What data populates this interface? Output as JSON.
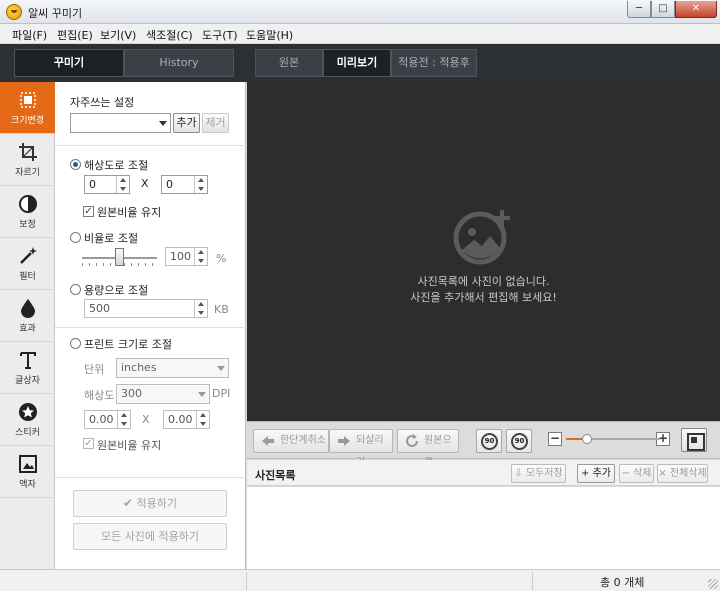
{
  "window": {
    "title": "알씨 꾸미기",
    "min": "─",
    "max": "□",
    "close": "✕"
  },
  "menu": [
    "파일(F)",
    "편집(E)",
    "보기(V)",
    "색조절(C)",
    "도구(T)",
    "도움말(H)"
  ],
  "mode_tabs": {
    "edit": "꾸미기",
    "history": "History"
  },
  "view_tabs": {
    "original": "원본",
    "preview": "미리보기",
    "before_after": "적용전 : 적용후"
  },
  "tools": [
    "크기변경",
    "자르기",
    "보정",
    "필터",
    "효과",
    "글상자",
    "스티커",
    "액자"
  ],
  "panel": {
    "favorites_label": "자주쓰는 설정",
    "favorites_value": "",
    "add_button": "추가",
    "remove_button": "제거",
    "resolution": {
      "label": "해상도로 조절",
      "width": "0",
      "height": "0",
      "x_sep": "X",
      "keep_ratio": "원본비율 유지"
    },
    "ratio": {
      "label": "비율로 조절",
      "value": "100",
      "unit": "%",
      "slider_percent": 50
    },
    "filesize": {
      "label": "용량으로 조절",
      "value": "500",
      "unit": "KB"
    },
    "print": {
      "label": "프린트 크기로 조절",
      "unit_label": "단위",
      "unit_value": "inches",
      "dpi_label": "해상도",
      "dpi_value": "300",
      "dpi_unit": "DPI",
      "width": "0.00",
      "height": "0.00",
      "x_sep": "X",
      "keep_ratio": "원본비율 유지"
    },
    "apply_button": "적용하기",
    "apply_all_button": "모든 사진에 적용하기"
  },
  "preview": {
    "message_line1": "사진목록에 사진이 없습니다.",
    "message_line2": "사진을 추가해서 편집해 보세요!"
  },
  "edit_toolbar": {
    "undo": "한단계취소",
    "redo": "되살리기",
    "restore": "원본으로",
    "rotate_left": "90",
    "rotate_right": "90",
    "zoom_minus": "−",
    "zoom_plus": "+",
    "zoom_percent": 22
  },
  "photo_list": {
    "title": "사진목록",
    "save_all": "모두저장",
    "add": "+ 추가",
    "delete": "− 삭제",
    "delete_all": "× 전체삭제"
  },
  "status": {
    "count": "총 0 개체"
  },
  "colors": {
    "accent": "#e46a17",
    "dark_bg": "#2d2d2d",
    "strip_bg": "#2c2f33"
  }
}
